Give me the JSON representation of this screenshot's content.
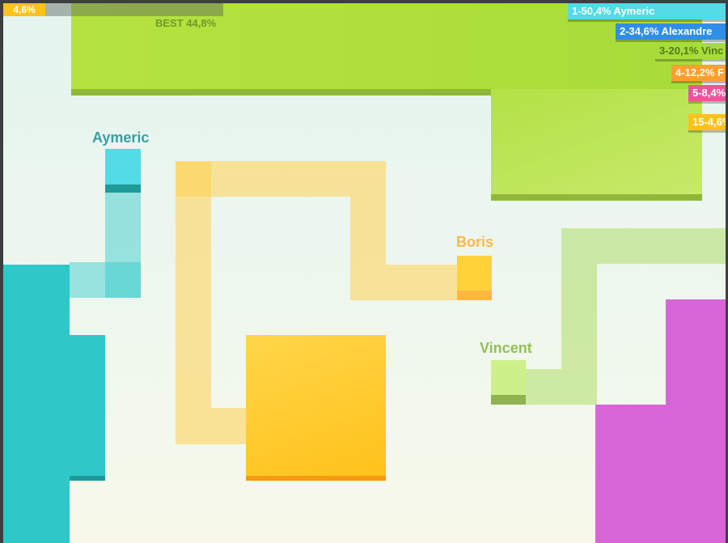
{
  "hud": {
    "my_percent": "4,6%",
    "best_label": "BEST 44,8%"
  },
  "leaderboard": [
    {
      "text": "1-50,4% Aymeric",
      "color": "#53dbe6"
    },
    {
      "text": "2-34,6% Alexandre",
      "color": "#2f8fe8"
    },
    {
      "text": "3-20,1% Vinc",
      "color": "#a8dc3a"
    },
    {
      "text": "4-12,2% F",
      "color": "#ff9f2e"
    },
    {
      "text": "5-8,4%",
      "color": "#e8579a"
    },
    {
      "text": "15-4,6%",
      "color": "#ffc21a"
    }
  ],
  "players": {
    "aymeric": {
      "name": "Aymeric",
      "color": "#27c6c6"
    },
    "boris": {
      "name": "Boris",
      "color": "#ffc21a"
    },
    "vincent": {
      "name": "Vincent",
      "color": "#9ccc3c"
    },
    "alexandre": {
      "color": "#2f8fe8"
    },
    "pink": {
      "color": "#d865d8"
    },
    "green_territory": {
      "color": "#a8dc3a"
    }
  }
}
